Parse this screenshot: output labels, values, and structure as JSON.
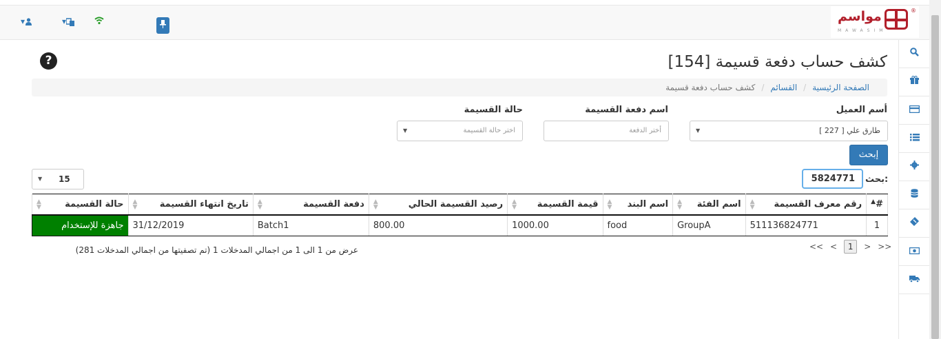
{
  "topbar": {
    "user_icon": "user-icon",
    "language_icon": "translate-icon",
    "wifi_icon": "wifi-icon",
    "pin_icon": "pin-icon",
    "logo": {
      "text": "مواسم",
      "sub": "MAWASIM",
      "reg": "®",
      "brand_color": "#b21f2b"
    }
  },
  "sidebar": {
    "items": [
      "search-icon",
      "gift-icon",
      "credit-card-icon",
      "list-icon",
      "gear-icon",
      "database-icon",
      "ticket-icon",
      "money-icon",
      "truck-icon"
    ]
  },
  "page": {
    "title": "كشف حساب دفعة قسيمة [154]",
    "help": "?"
  },
  "breadcrumb": [
    "الصفحة الرئيسية",
    "القسائم",
    "كشف حساب دفعة قسيمة"
  ],
  "filters": {
    "customer_label": "أسم العميل",
    "customer_value": "طارق علي [ 227 ]",
    "batch_label": "اسم دفعة القسيمة",
    "batch_placeholder": "أختر الدفعة",
    "status_label": "حالة القسيمة",
    "status_placeholder": "اختر حالة القسيمة",
    "search_button": "إبحث"
  },
  "table_controls": {
    "page_size": "15",
    "search_label": ":بحث",
    "search_value": "5824771"
  },
  "table": {
    "columns": [
      "#",
      "رقم معرف القسيمة",
      "اسم الفئة",
      "اسم البند",
      "قيمة القسيمة",
      "رصيد القسيمة الحالي",
      "دفعة القسيمة",
      "تاريخ انتهاء القسيمة",
      "حالة القسيمة"
    ],
    "rows": [
      [
        "1",
        "511136824771",
        "GroupA",
        "food",
        "1000.00",
        "800.00",
        "Batch1",
        "31/12/2019",
        "جاهزة للإستخدام"
      ]
    ],
    "status_color": "#008000"
  },
  "footer": {
    "info": "عرض من 1 الى 1 من اجمالي المدخلات 1 (تم تصفيتها من اجمالي المدخلات 281)",
    "pager": {
      "first": "<<",
      "prev": "<",
      "current": "1",
      "next": ">",
      "last": ">>"
    }
  },
  "colors": {
    "primary": "#337ab7",
    "success": "#008000"
  }
}
